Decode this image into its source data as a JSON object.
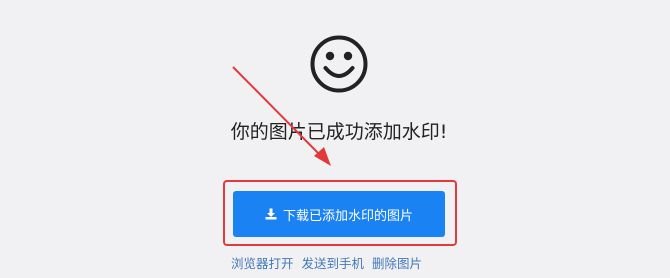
{
  "success": {
    "icon": "smiley-face-icon",
    "message": "你的图片已成功添加水印!"
  },
  "download": {
    "icon": "download-icon",
    "label": "下载已添加水印的图片"
  },
  "links": {
    "open_browser": "浏览器打开",
    "send_phone": "发送到手机",
    "delete_image": "删除图片"
  },
  "colors": {
    "background": "#f1f1f3",
    "button": "#1a82f2",
    "annotation": "#e23a3a",
    "link": "#4478b8"
  }
}
